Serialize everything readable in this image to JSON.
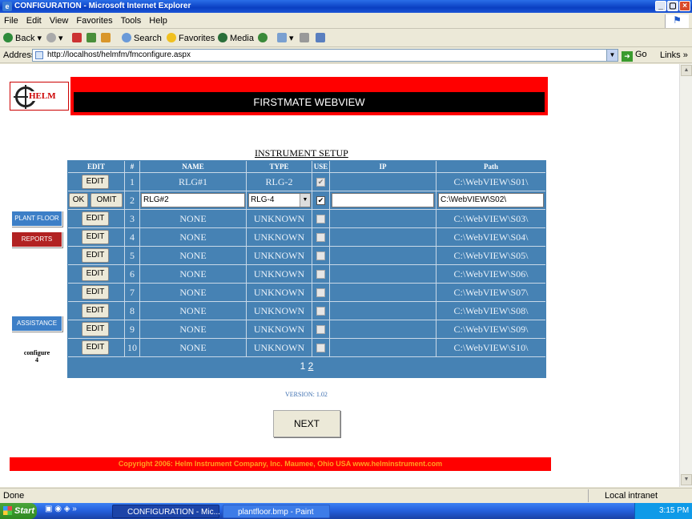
{
  "window": {
    "title": "CONFIGURATION - Microsoft Internet Explorer"
  },
  "menu": [
    "File",
    "Edit",
    "View",
    "Favorites",
    "Tools",
    "Help"
  ],
  "toolbar": {
    "back": "Back",
    "search": "Search",
    "favorites": "Favorites",
    "media": "Media"
  },
  "address": {
    "label": "Address",
    "url": "http://localhost/helmfm/fmconfigure.aspx",
    "go": "Go",
    "links": "Links"
  },
  "page": {
    "logo_text": "HELM",
    "banner": "FIRSTMATE WEBVIEW",
    "side_buttons": {
      "plant_floor": "PLANT FLOOR",
      "reports": "REPORTS",
      "assistance": "ASSISTANCE"
    },
    "configure_label": "configure",
    "configure_num": "4",
    "setup_title": "INSTRUMENT SETUP",
    "headers": {
      "edit": "EDIT",
      "num": "#",
      "name": "NAME",
      "type": "TYPE",
      "use": "USE",
      "ip": "IP",
      "path": "Path"
    },
    "ok": "OK",
    "omit": "OMIT",
    "edit_label": "EDIT",
    "rows": [
      {
        "num": "1",
        "name": "RLG#1",
        "type": "RLG-2",
        "use": true,
        "ip": "",
        "path": "C:\\WebVIEW\\S01\\"
      },
      {
        "num": "2",
        "name": "RLG#2",
        "type": "RLG-4",
        "use": true,
        "ip": "",
        "path": "C:\\WebVIEW\\S02\\"
      },
      {
        "num": "3",
        "name": "NONE",
        "type": "UNKNOWN",
        "use": false,
        "ip": "",
        "path": "C:\\WebVIEW\\S03\\"
      },
      {
        "num": "4",
        "name": "NONE",
        "type": "UNKNOWN",
        "use": false,
        "ip": "",
        "path": "C:\\WebVIEW\\S04\\"
      },
      {
        "num": "5",
        "name": "NONE",
        "type": "UNKNOWN",
        "use": false,
        "ip": "",
        "path": "C:\\WebVIEW\\S05\\"
      },
      {
        "num": "6",
        "name": "NONE",
        "type": "UNKNOWN",
        "use": false,
        "ip": "",
        "path": "C:\\WebVIEW\\S06\\"
      },
      {
        "num": "7",
        "name": "NONE",
        "type": "UNKNOWN",
        "use": false,
        "ip": "",
        "path": "C:\\WebVIEW\\S07\\"
      },
      {
        "num": "8",
        "name": "NONE",
        "type": "UNKNOWN",
        "use": false,
        "ip": "",
        "path": "C:\\WebVIEW\\S08\\"
      },
      {
        "num": "9",
        "name": "NONE",
        "type": "UNKNOWN",
        "use": false,
        "ip": "",
        "path": "C:\\WebVIEW\\S09\\"
      },
      {
        "num": "10",
        "name": "NONE",
        "type": "UNKNOWN",
        "use": false,
        "ip": "",
        "path": "C:\\WebVIEW\\S10\\"
      }
    ],
    "pager": {
      "page1": "1",
      "page2": "2"
    },
    "version": "VERSION: 1.02",
    "next": "NEXT",
    "footer": "Copyright 2006: Helm Instrument Company, Inc.  Maumee, Ohio USA  www.helminstrument.com"
  },
  "status": {
    "text": "Done",
    "zone": "Local intranet"
  },
  "taskbar": {
    "start": "Start",
    "task1": "CONFIGURATION - Mic...",
    "task2": "plantfloor.bmp - Paint",
    "clock": "3:15 PM"
  },
  "colors": {
    "grid": "#4682b4",
    "banner": "#ff0000",
    "footer_text": "#ffa020"
  }
}
